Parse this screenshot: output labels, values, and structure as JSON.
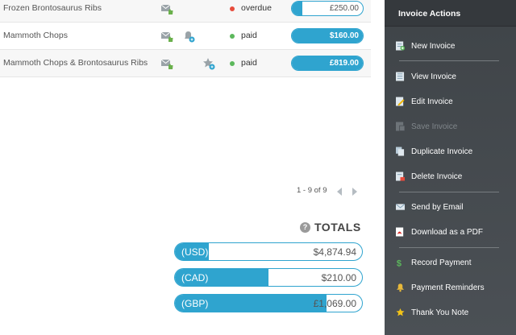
{
  "invoices": [
    {
      "name": "Frozen Brontosaurus Ribs",
      "status": "overdue",
      "status_color": "#e74c3c",
      "amount": "£250.00",
      "bar_fill": 0.15
    },
    {
      "name": "Mammoth Chops",
      "status": "paid",
      "status_color": "#5cb85c",
      "amount": "$160.00",
      "bar_fill": 1
    },
    {
      "name": "Mammoth Chops & Brontosaurus Ribs",
      "status": "paid",
      "status_color": "#5cb85c",
      "amount": "£819.00",
      "bar_fill": 1
    }
  ],
  "pagination": {
    "label": "1 - 9 of 9"
  },
  "totals": {
    "title": "TOTALS",
    "help_icon": "?",
    "rows": [
      {
        "currency": "(USD)",
        "amount": "$4,874.94",
        "bar_fill": 0.18
      },
      {
        "currency": "(CAD)",
        "amount": "$210.00",
        "bar_fill": 0.5
      },
      {
        "currency": "(GBP)",
        "amount": "£1,069.00",
        "bar_fill": 0.81
      }
    ]
  },
  "sidebar": {
    "title": "Invoice Actions",
    "items": [
      {
        "label": "New Invoice",
        "icon": "new-invoice-icon",
        "enabled": true
      },
      {
        "label": "View Invoice",
        "icon": "view-invoice-icon",
        "enabled": true
      },
      {
        "label": "Edit Invoice",
        "icon": "edit-invoice-icon",
        "enabled": true
      },
      {
        "label": "Save Invoice",
        "icon": "save-invoice-icon",
        "enabled": false
      },
      {
        "label": "Duplicate Invoice",
        "icon": "duplicate-invoice-icon",
        "enabled": true
      },
      {
        "label": "Delete Invoice",
        "icon": "delete-invoice-icon",
        "enabled": true
      },
      {
        "label": "Send by Email",
        "icon": "email-icon",
        "enabled": true
      },
      {
        "label": "Download as a PDF",
        "icon": "pdf-icon",
        "enabled": true
      },
      {
        "label": "Record Payment",
        "icon": "dollar-icon",
        "enabled": true
      },
      {
        "label": "Payment Reminders",
        "icon": "bell-icon",
        "enabled": true
      },
      {
        "label": "Thank You Note",
        "icon": "star-icon",
        "enabled": true
      }
    ]
  },
  "colors": {
    "accent": "#2fa4cf",
    "sidebar_bg": "#43484c",
    "paid": "#5cb85c",
    "overdue": "#e74c3c"
  }
}
